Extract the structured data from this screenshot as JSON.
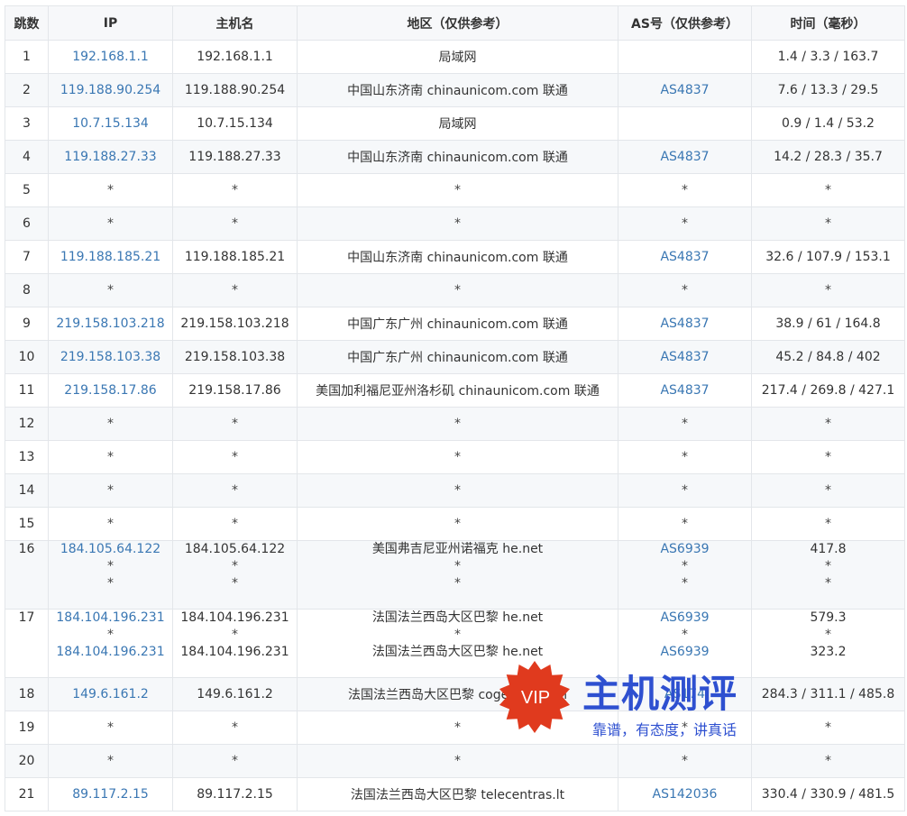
{
  "headers": [
    "跳数",
    "IP",
    "主机名",
    "地区（仅供参考）",
    "AS号（仅供参考）",
    "时间（毫秒）"
  ],
  "rows": [
    {
      "hop": "1",
      "ip": [
        "192.168.1.1"
      ],
      "host": [
        "192.168.1.1"
      ],
      "region": [
        "局域网"
      ],
      "as": [
        ""
      ],
      "time": [
        "1.4 / 3.3 / 163.7"
      ]
    },
    {
      "hop": "2",
      "ip": [
        "119.188.90.254"
      ],
      "host": [
        "119.188.90.254"
      ],
      "region": [
        "中国山东济南 chinaunicom.com 联通"
      ],
      "as": [
        "AS4837"
      ],
      "time": [
        "7.6 / 13.3 / 29.5"
      ]
    },
    {
      "hop": "3",
      "ip": [
        "10.7.15.134"
      ],
      "host": [
        "10.7.15.134"
      ],
      "region": [
        "局域网"
      ],
      "as": [
        ""
      ],
      "time": [
        "0.9 / 1.4 / 53.2"
      ]
    },
    {
      "hop": "4",
      "ip": [
        "119.188.27.33"
      ],
      "host": [
        "119.188.27.33"
      ],
      "region": [
        "中国山东济南 chinaunicom.com 联通"
      ],
      "as": [
        "AS4837"
      ],
      "time": [
        "14.2 / 28.3 / 35.7"
      ]
    },
    {
      "hop": "5",
      "ip": [
        "*"
      ],
      "host": [
        "*"
      ],
      "region": [
        "*"
      ],
      "as": [
        "*"
      ],
      "time": [
        "*"
      ]
    },
    {
      "hop": "6",
      "ip": [
        "*"
      ],
      "host": [
        "*"
      ],
      "region": [
        "*"
      ],
      "as": [
        "*"
      ],
      "time": [
        "*"
      ]
    },
    {
      "hop": "7",
      "ip": [
        "119.188.185.21"
      ],
      "host": [
        "119.188.185.21"
      ],
      "region": [
        "中国山东济南 chinaunicom.com 联通"
      ],
      "as": [
        "AS4837"
      ],
      "time": [
        "32.6 / 107.9 / 153.1"
      ]
    },
    {
      "hop": "8",
      "ip": [
        "*"
      ],
      "host": [
        "*"
      ],
      "region": [
        "*"
      ],
      "as": [
        "*"
      ],
      "time": [
        "*"
      ]
    },
    {
      "hop": "9",
      "ip": [
        "219.158.103.218"
      ],
      "host": [
        "219.158.103.218"
      ],
      "region": [
        "中国广东广州 chinaunicom.com 联通"
      ],
      "as": [
        "AS4837"
      ],
      "time": [
        "38.9 / 61 / 164.8"
      ]
    },
    {
      "hop": "10",
      "ip": [
        "219.158.103.38"
      ],
      "host": [
        "219.158.103.38"
      ],
      "region": [
        "中国广东广州 chinaunicom.com 联通"
      ],
      "as": [
        "AS4837"
      ],
      "time": [
        "45.2 / 84.8 / 402"
      ]
    },
    {
      "hop": "11",
      "ip": [
        "219.158.17.86"
      ],
      "host": [
        "219.158.17.86"
      ],
      "region": [
        "美国加利福尼亚州洛杉矶 chinaunicom.com 联通"
      ],
      "as": [
        "AS4837"
      ],
      "time": [
        "217.4 / 269.8 / 427.1"
      ]
    },
    {
      "hop": "12",
      "ip": [
        "*"
      ],
      "host": [
        "*"
      ],
      "region": [
        "*"
      ],
      "as": [
        "*"
      ],
      "time": [
        "*"
      ]
    },
    {
      "hop": "13",
      "ip": [
        "*"
      ],
      "host": [
        "*"
      ],
      "region": [
        "*"
      ],
      "as": [
        "*"
      ],
      "time": [
        "*"
      ]
    },
    {
      "hop": "14",
      "ip": [
        "*"
      ],
      "host": [
        "*"
      ],
      "region": [
        "*"
      ],
      "as": [
        "*"
      ],
      "time": [
        "*"
      ]
    },
    {
      "hop": "15",
      "ip": [
        "*"
      ],
      "host": [
        "*"
      ],
      "region": [
        "*"
      ],
      "as": [
        "*"
      ],
      "time": [
        "*"
      ]
    },
    {
      "hop": "16",
      "ip": [
        "184.105.64.122",
        "*",
        "*"
      ],
      "host": [
        "184.105.64.122",
        "*",
        "*"
      ],
      "region": [
        "美国弗吉尼亚州诺福克 he.net",
        "*",
        "*"
      ],
      "as": [
        "AS6939",
        "*",
        "*"
      ],
      "time": [
        "417.8",
        "*",
        "*"
      ]
    },
    {
      "hop": "17",
      "ip": [
        "184.104.196.231",
        "*",
        "184.104.196.231"
      ],
      "host": [
        "184.104.196.231",
        "*",
        "184.104.196.231"
      ],
      "region": [
        "法国法兰西岛大区巴黎 he.net",
        "*",
        "法国法兰西岛大区巴黎 he.net"
      ],
      "as": [
        "AS6939",
        "*",
        "AS6939"
      ],
      "time": [
        "579.3",
        "*",
        "323.2"
      ]
    },
    {
      "hop": "18",
      "ip": [
        "149.6.161.2"
      ],
      "host": [
        "149.6.161.2"
      ],
      "region": [
        "法国法兰西岛大区巴黎 cogentco.com"
      ],
      "as": [
        "AS174"
      ],
      "time": [
        "284.3 / 311.1 / 485.8"
      ]
    },
    {
      "hop": "19",
      "ip": [
        "*"
      ],
      "host": [
        "*"
      ],
      "region": [
        "*"
      ],
      "as": [
        "*"
      ],
      "time": [
        "*"
      ]
    },
    {
      "hop": "20",
      "ip": [
        "*"
      ],
      "host": [
        "*"
      ],
      "region": [
        "*"
      ],
      "as": [
        "*"
      ],
      "time": [
        "*"
      ]
    },
    {
      "hop": "21",
      "ip": [
        "89.117.2.15"
      ],
      "host": [
        "89.117.2.15"
      ],
      "region": [
        "法国法兰西岛大区巴黎 telecentras.lt"
      ],
      "as": [
        "AS142036"
      ],
      "time": [
        "330.4 / 330.9 / 481.5"
      ]
    }
  ],
  "watermark": {
    "badge": "VIP",
    "title": "主机测评",
    "slogan": "靠谱，有态度，讲真话"
  },
  "colors": {
    "link": "#3a77b3",
    "border": "#e3e6ea",
    "header_bg": "#f7f8fa",
    "stripe_bg": "#f6f8fa",
    "watermark_red": "#e03a1e",
    "watermark_blue": "#2e50d0"
  }
}
